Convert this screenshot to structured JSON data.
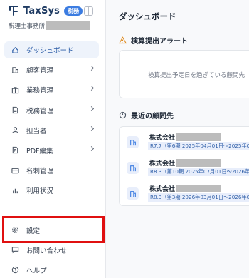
{
  "brand": {
    "name": "TaxSys",
    "badge": "税務"
  },
  "office": {
    "label": "税理士事務所"
  },
  "nav": {
    "items": [
      {
        "label": "ダッシュボード"
      },
      {
        "label": "顧客管理"
      },
      {
        "label": "業務管理"
      },
      {
        "label": "税務管理"
      },
      {
        "label": "担当者"
      },
      {
        "label": "PDF編集"
      },
      {
        "label": "名刺管理"
      },
      {
        "label": "利用状況"
      }
    ],
    "bottom": [
      {
        "label": "設定"
      },
      {
        "label": "お問い合わせ"
      },
      {
        "label": "ヘルプ"
      }
    ]
  },
  "main": {
    "title": "ダッシュボード",
    "alert": {
      "heading": "検算提出アラート",
      "empty_text": "検算提出予定日を過ぎている顧問先"
    },
    "clients": {
      "heading": "最近の顧問先",
      "rows": [
        {
          "name": "株式会社",
          "tag": "R7.7（第6期 2025年04月01日～2025年0"
        },
        {
          "name": "株式会社",
          "tag": "R8.3（第10期 2025年07月01日～2026年"
        },
        {
          "name": "株式会社",
          "tag": "R8.3（第3期 2026年03月01日～2026年0"
        }
      ]
    }
  },
  "colors": {
    "accent": "#3b7ce1",
    "highlight": "#e01010",
    "active_bg": "#eef3fb"
  }
}
